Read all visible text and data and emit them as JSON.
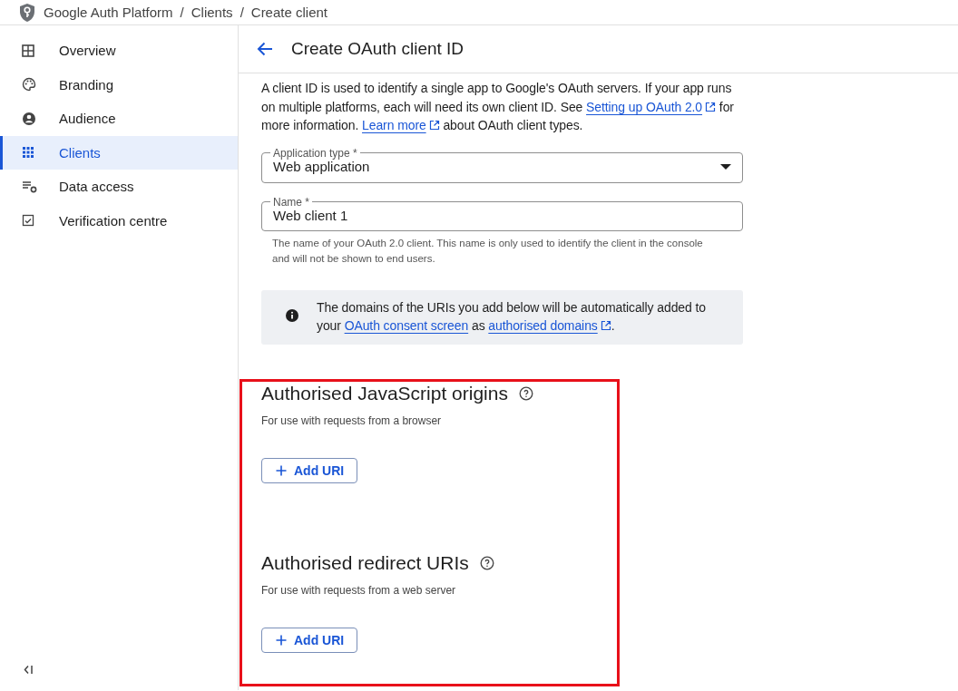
{
  "breadcrumb": [
    {
      "label": "Google Auth Platform"
    },
    {
      "separator": "/",
      "label": "Clients"
    },
    {
      "separator": "/",
      "label": "Create client"
    }
  ],
  "sidebar": {
    "items": [
      {
        "label": "Overview",
        "selected": false
      },
      {
        "label": "Branding",
        "selected": false
      },
      {
        "label": "Audience",
        "selected": false
      },
      {
        "label": "Clients",
        "selected": true
      },
      {
        "label": "Data access",
        "selected": false
      },
      {
        "label": "Verification centre",
        "selected": false
      }
    ]
  },
  "page": {
    "title": "Create OAuth client ID",
    "description": [
      {
        "text": "A client ID is used to identify a single app to Google's OAuth servers. If your app runs on multiple platforms, each will need its own client ID. See "
      },
      {
        "link": "Setting up OAuth 2.0",
        "external": true
      },
      {
        "text": " for more information. "
      },
      {
        "link": "Learn more",
        "external": true
      },
      {
        "text": " about OAuth client types."
      }
    ],
    "application_type": {
      "label": "Application type *",
      "value": "Web application"
    },
    "name": {
      "label": "Name *",
      "value": "Web client 1",
      "helper": "The name of your OAuth 2.0 client. This name is only used to identify the client in the console and will not be shown to end users."
    },
    "notice": [
      {
        "text": "The domains of the URIs you add below will be automatically added to your "
      },
      {
        "link": "OAuth consent screen",
        "external": false
      },
      {
        "text": " as "
      },
      {
        "link": "authorised domains",
        "external": true
      },
      {
        "text": "."
      }
    ],
    "sections": [
      {
        "title": "Authorised JavaScript origins",
        "subtitle": "For use with requests from a browser",
        "button": "Add URI"
      },
      {
        "title": "Authorised redirect URIs",
        "subtitle": "For use with requests from a web server",
        "button": "Add URI"
      }
    ]
  }
}
